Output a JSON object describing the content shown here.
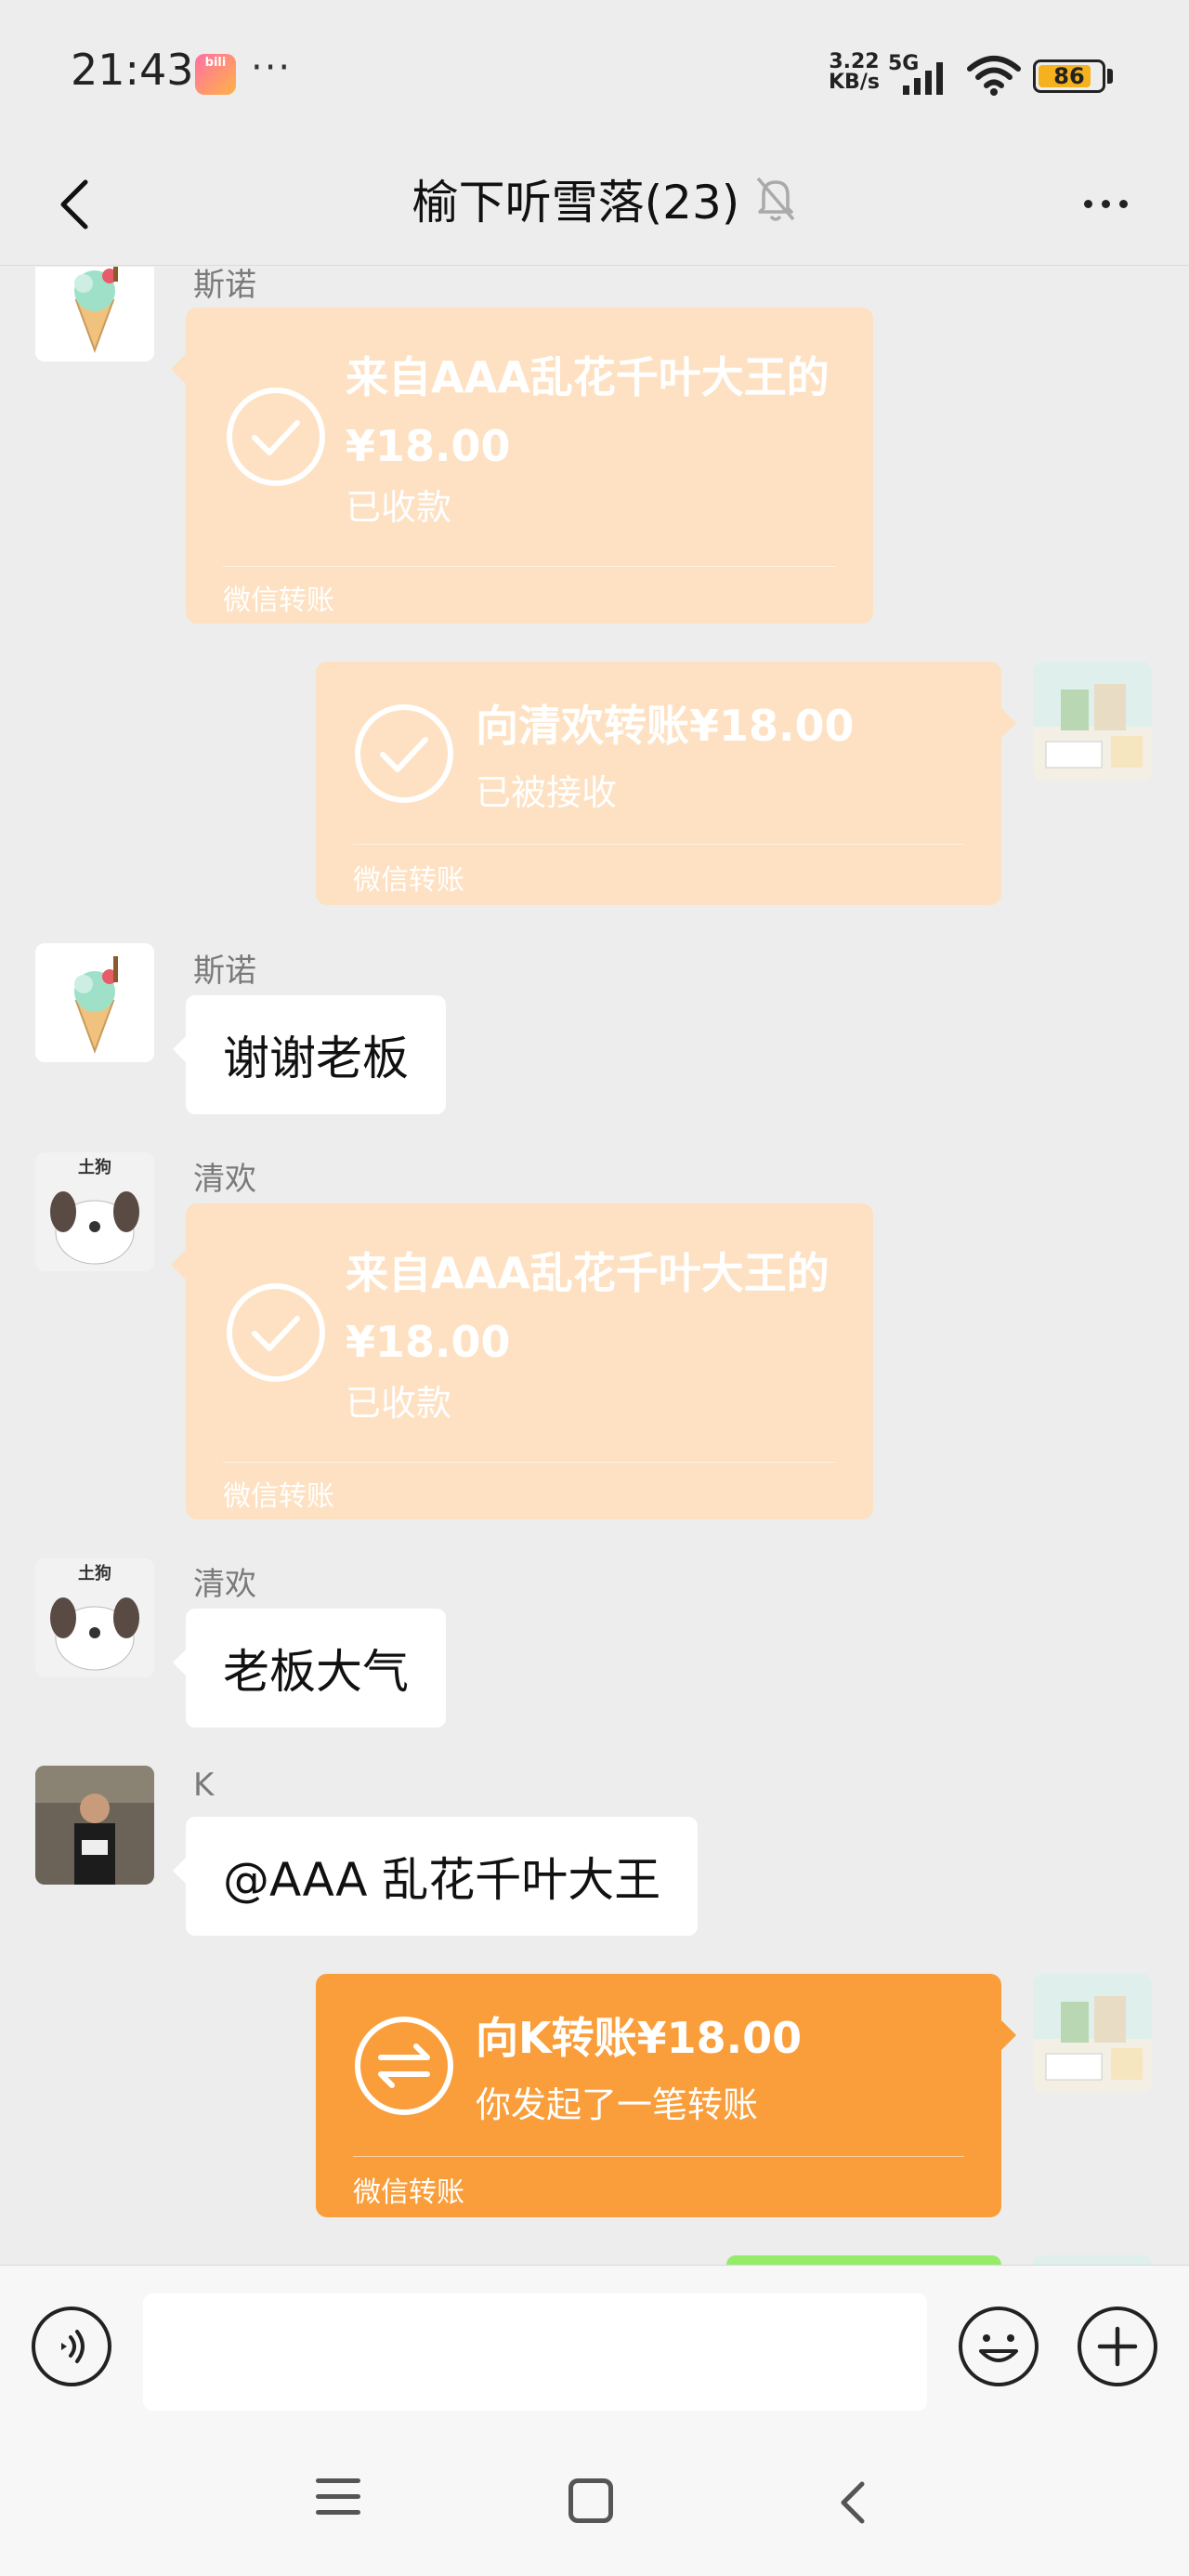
{
  "status_bar": {
    "time": "21:43",
    "app_icon": "bilibili-icon",
    "overflow": "···",
    "net_speed_value": "3.22",
    "net_speed_unit": "KB/s",
    "network_type": "5G",
    "battery": "86",
    "battery_level": 0.86
  },
  "header": {
    "title": "榆下听雪落(23)",
    "back_icon": "chevron-left-icon",
    "mute_icon": "bell-off-icon",
    "more_icon": "more-dots-icon"
  },
  "messages": [
    {
      "type": "transfer",
      "side": "left",
      "sender": "斯诺",
      "title": "来自AAA乱花千叶大王的¥18.00",
      "subtitle": "已收款",
      "footer": "微信转账",
      "state": "received"
    },
    {
      "type": "transfer",
      "side": "right",
      "title": "向清欢转账¥18.00",
      "subtitle": "已被接收",
      "footer": "微信转账",
      "state": "accepted"
    },
    {
      "type": "text",
      "side": "left",
      "sender": "斯诺",
      "text": "谢谢老板"
    },
    {
      "type": "transfer",
      "side": "left",
      "sender": "清欢",
      "avatar_label": "土狗",
      "title": "来自AAA乱花千叶大王的¥18.00",
      "subtitle": "已收款",
      "footer": "微信转账",
      "state": "received"
    },
    {
      "type": "text",
      "side": "left",
      "sender": "清欢",
      "avatar_label": "土狗",
      "text": "老板大气"
    },
    {
      "type": "text",
      "side": "left",
      "sender": "K",
      "text": "@AAA 乱花千叶大王"
    },
    {
      "type": "transfer",
      "side": "right",
      "title": "向K转账¥18.00",
      "subtitle": "你发起了一笔转账",
      "footer": "微信转账",
      "state": "pending"
    }
  ],
  "input_bar": {
    "value": "",
    "voice_icon": "voice-icon",
    "emoji_icon": "emoji-icon",
    "plus_icon": "plus-icon"
  },
  "nav_bar": {
    "menu_icon": "menu-icon",
    "home_icon": "home-icon",
    "back_icon": "back-icon"
  },
  "colors": {
    "background": "#ededed",
    "transfer_done": "#fde1c2",
    "transfer_pending": "#f99e3a",
    "bubble": "#ffffff",
    "sent_text_bubble": "#95ec69"
  }
}
